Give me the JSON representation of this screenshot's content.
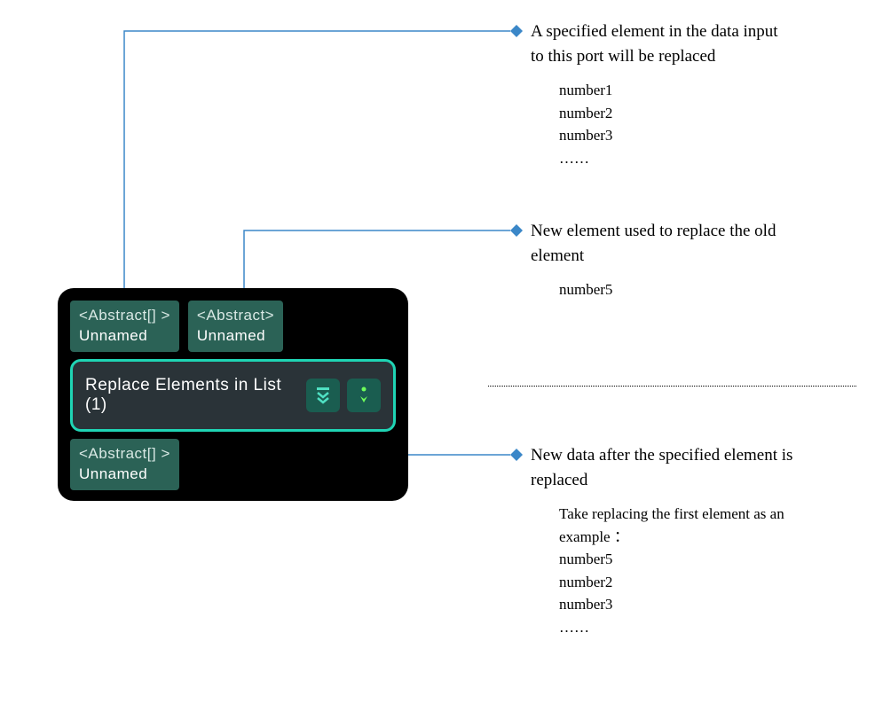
{
  "node": {
    "title": "Replace Elements in List (1)",
    "ports": {
      "input1": {
        "type": "<Abstract[] >",
        "name": "Unnamed"
      },
      "input2": {
        "type": "<Abstract>",
        "name": "Unnamed"
      },
      "output1": {
        "type": "<Abstract[] >",
        "name": "Unnamed"
      }
    }
  },
  "annotations": {
    "input1": {
      "title": "A specified element in the data input to this port will be replaced",
      "items": [
        "number1",
        "number2",
        "number3",
        "……"
      ]
    },
    "input2": {
      "title": "New element used to replace the old element",
      "items": [
        "number5"
      ]
    },
    "output1": {
      "title": "New data after the specified element is replaced",
      "intro": "Take replacing the first element as an example ：",
      "items": [
        "number5",
        "number2",
        "number3",
        "……"
      ]
    }
  }
}
